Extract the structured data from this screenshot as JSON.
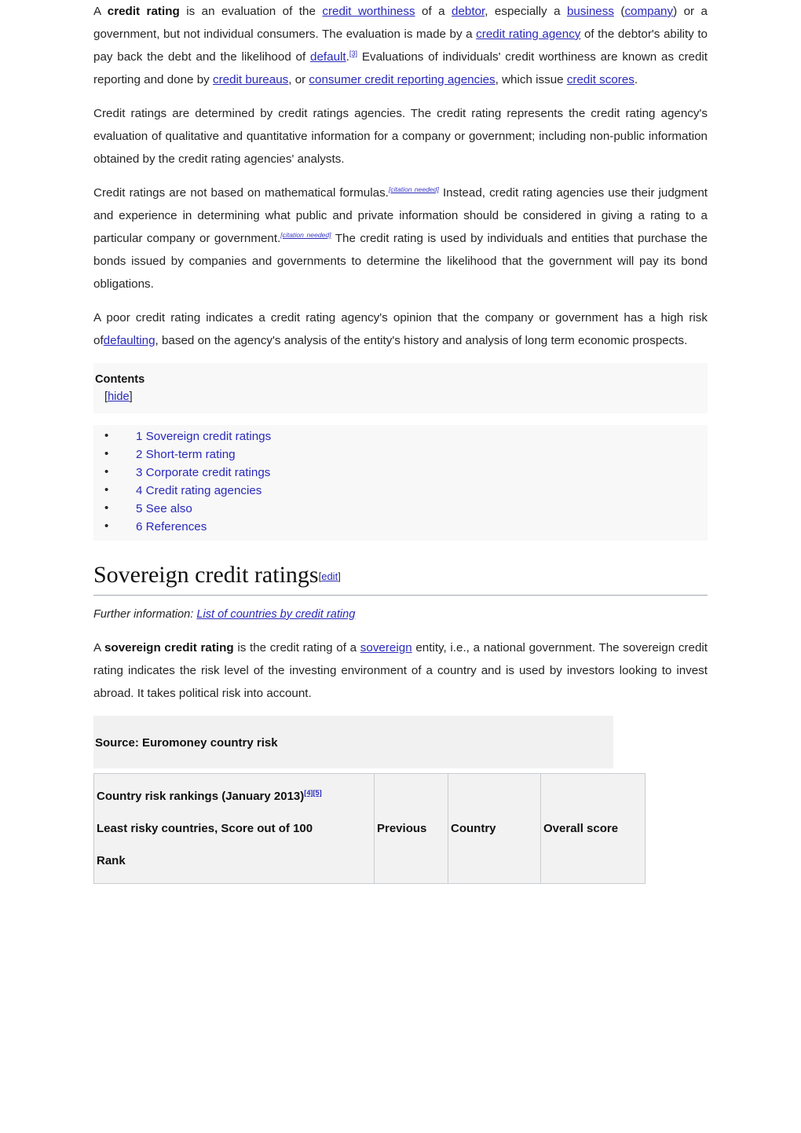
{
  "article": {
    "paragraphs": [
      {
        "id": "intro",
        "runs": [
          {
            "t": "A ",
            "k": "text"
          },
          {
            "t": "credit   rating",
            "k": "bold"
          },
          {
            "t": " is   an   evaluation   of   the ",
            "k": "text"
          },
          {
            "t": "credit   worthiness",
            "k": "link"
          },
          {
            "t": " of   a ",
            "k": "text"
          },
          {
            "t": "debtor",
            "k": "link"
          },
          {
            "t": ",   especially a ",
            "k": "text"
          },
          {
            "t": "business",
            "k": "link"
          },
          {
            "t": " (",
            "k": "text"
          },
          {
            "t": "company",
            "k": "link"
          },
          {
            "t": ") or a government, but not individual consumers. The evaluation is made by a ",
            "k": "text"
          },
          {
            "t": "credit   rating   agency",
            "k": "link"
          },
          {
            "t": " of   the   debtor's   ability   to   pay   back   the   debt   and   the   likelihood of ",
            "k": "text"
          },
          {
            "t": "default",
            "k": "link"
          },
          {
            "t": ".",
            "k": "text"
          },
          {
            "t": "[3]",
            "k": "ref"
          },
          {
            "t": " Evaluations of individuals' credit worthiness are known as credit reporting and done by ",
            "k": "text"
          },
          {
            "t": "credit bureaus",
            "k": "link"
          },
          {
            "t": ", or ",
            "k": "text"
          },
          {
            "t": "consumer credit reporting agencies",
            "k": "link"
          },
          {
            "t": ", which issue ",
            "k": "text"
          },
          {
            "t": "credit scores",
            "k": "link"
          },
          {
            "t": ".",
            "k": "text"
          }
        ]
      },
      {
        "id": "determined",
        "runs": [
          {
            "t": "Credit ratings are determined by credit ratings agencies. The credit rating represents the credit rating   agency's   evaluation   of   qualitative   and   quantitative   information   for   a   company   or government; including non-public information obtained by the credit rating agencies' analysts.",
            "k": "text"
          }
        ]
      },
      {
        "id": "not-formulas",
        "runs": [
          {
            "t": "Credit ratings are not based on mathematical formulas.",
            "k": "text"
          },
          {
            "t": "[citation needed]",
            "k": "cn"
          },
          {
            "t": " Instead, credit rating agencies use their judgment and experience in determining what public and private information should be considered in giving a rating to a particular company or government.",
            "k": "text"
          },
          {
            "t": "[citation needed]",
            "k": "cn"
          },
          {
            "t": " The credit rating is used by individuals and entities that purchase the bonds issued by companies and governments to determine the likelihood that the government will pay its bond obligations.",
            "k": "text"
          }
        ]
      },
      {
        "id": "poor-rating",
        "runs": [
          {
            "t": "A poor credit rating indicates a credit rating agency's opinion that the company or government has a high risk of",
            "k": "text"
          },
          {
            "t": "defaulting",
            "k": "link"
          },
          {
            "t": ", based on the agency's analysis of the entity's history and analysis of long term economic prospects.",
            "k": "text"
          }
        ]
      }
    ],
    "contents": {
      "title": "Contents",
      "hide_open": "[",
      "hide_label": "hide",
      "hide_close": "]",
      "items": [
        {
          "label": "1 Sovereign credit ratings"
        },
        {
          "label": "2 Short-term rating"
        },
        {
          "label": "3 Corporate credit ratings"
        },
        {
          "label": "4 Credit rating agencies"
        },
        {
          "label": "5 See also"
        },
        {
          "label": "6 References"
        }
      ]
    },
    "section": {
      "heading": "Sovereign credit ratings",
      "edit_open": "[",
      "edit_label": "edit",
      "edit_close": "]",
      "further_prefix": "Further information: ",
      "further_link": "List of countries by credit rating",
      "paragraph": {
        "runs": [
          {
            "t": "A ",
            "k": "text"
          },
          {
            "t": "sovereign credit rating",
            "k": "bold"
          },
          {
            "t": " is the credit rating of a ",
            "k": "text"
          },
          {
            "t": "sovereign",
            "k": "link"
          },
          {
            "t": " entity, i.e., a national government. The sovereign credit rating indicates the risk level of the investing environment of a country and is used by investors looking to invest abroad. It takes political risk into account.",
            "k": "text"
          }
        ]
      }
    },
    "table": {
      "source_label": "Source: Euromoney country risk",
      "header_col1_line1": "Country risk rankings (January 2013)",
      "header_col1_line1_ref": "[4][5]",
      "header_col1_line2": "Least risky countries, Score out of 100",
      "header_col1_line3": "Rank",
      "header_col2": "Previous",
      "header_col3": "Country",
      "header_col4": "Overall score"
    }
  },
  "colors": {
    "link": "#2a2aba",
    "text": "#252525",
    "box_bg": "#f8f8f8",
    "table_bg": "#f2f2f2",
    "table_border": "#c8ccd1",
    "rule": "#a2a9b1"
  }
}
